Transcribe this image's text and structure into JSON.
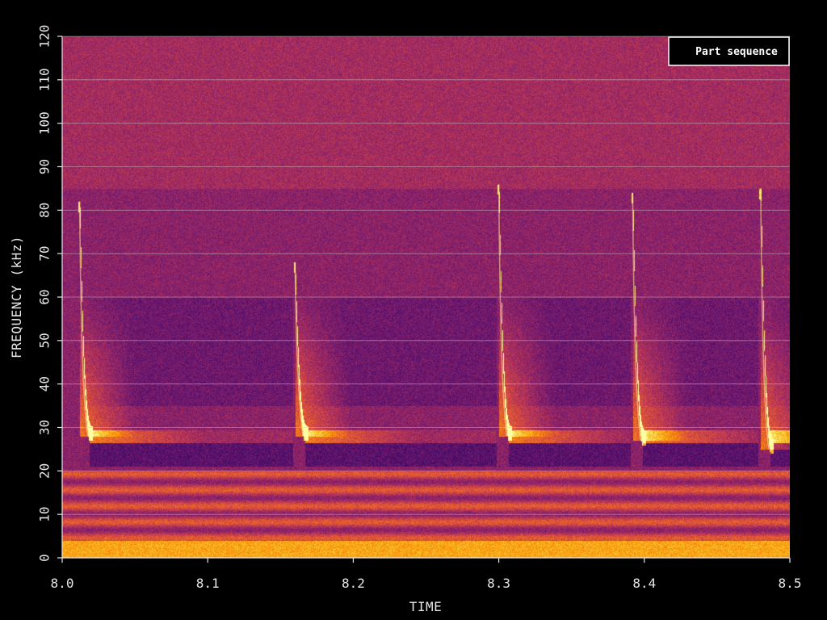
{
  "chart_data": {
    "type": "heatmap",
    "subtype": "spectrogram",
    "xlabel": "TIME",
    "ylabel": "FREQUENCY (kHz)",
    "xlim": [
      8.0,
      8.5
    ],
    "ylim": [
      0,
      120
    ],
    "x_ticks": [
      "8.0",
      "8.1",
      "8.2",
      "8.3",
      "8.4",
      "8.5"
    ],
    "y_ticks": [
      "0",
      "10",
      "20",
      "30",
      "40",
      "50",
      "60",
      "70",
      "80",
      "90",
      "100",
      "110",
      "120"
    ],
    "grid": "horizontal",
    "legend": {
      "label": "Part sequence",
      "placement": "top-right"
    },
    "colormap": [
      "#000004",
      "#1b0c41",
      "#4a0c6b",
      "#781c6d",
      "#a52c60",
      "#cf4446",
      "#ed6925",
      "#fb9b06",
      "#f7d13d",
      "#fcffa4"
    ],
    "colors": {
      "background": "#000000",
      "axis": "#e6e6e6",
      "grid": "#cfcfcf"
    },
    "calls": [
      {
        "time": 8.012,
        "start_freq_khz": 82,
        "end_freq_khz": 28
      },
      {
        "time": 8.16,
        "start_freq_khz": 68,
        "end_freq_khz": 28
      },
      {
        "time": 8.3,
        "start_freq_khz": 86,
        "end_freq_khz": 28
      },
      {
        "time": 8.392,
        "start_freq_khz": 84,
        "end_freq_khz": 27
      },
      {
        "time": 8.48,
        "start_freq_khz": 85,
        "end_freq_khz": 25
      }
    ]
  }
}
